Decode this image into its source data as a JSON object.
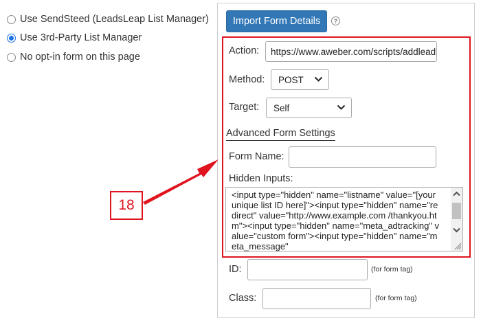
{
  "options": {
    "items": [
      {
        "label": "Use SendSteed (LeadsLeap List Manager)",
        "checked": false
      },
      {
        "label": "Use 3rd-Party List Manager",
        "checked": true
      },
      {
        "label": "No opt-in form on this page",
        "checked": false
      }
    ]
  },
  "panel": {
    "import_label": "Import Form Details",
    "help_icon": "?",
    "action_label": "Action:",
    "action_value": "https://www.aweber.com/scripts/addlead.",
    "method_label": "Method:",
    "method_value": "POST",
    "target_label": "Target:",
    "target_value": "Self",
    "advanced_label": "Advanced Form Settings",
    "form_name_label": "Form Name:",
    "form_name_value": "",
    "hidden_inputs_label": "Hidden Inputs:",
    "hidden_inputs_value": "<input type=\"hidden\" name=\"listname\" value=\"[your unique list ID here]\"><input type=\"hidden\" name=\"redirect\" value=\"http://www.example.com /thankyou.htm\"><input type=\"hidden\" name=\"meta_adtracking\" value=\"custom form\"><input type=\"hidden\" name=\"meta_message\"",
    "id_label": "ID:",
    "id_value": "",
    "id_hint": "(for form tag)",
    "class_label": "Class:",
    "class_value": "",
    "class_hint": "(for form tag)"
  },
  "annotation": {
    "step_number": "18"
  },
  "colors": {
    "accent": "#3278b7",
    "highlight": "#e0141e",
    "radio_selected": "#1a73e8"
  }
}
